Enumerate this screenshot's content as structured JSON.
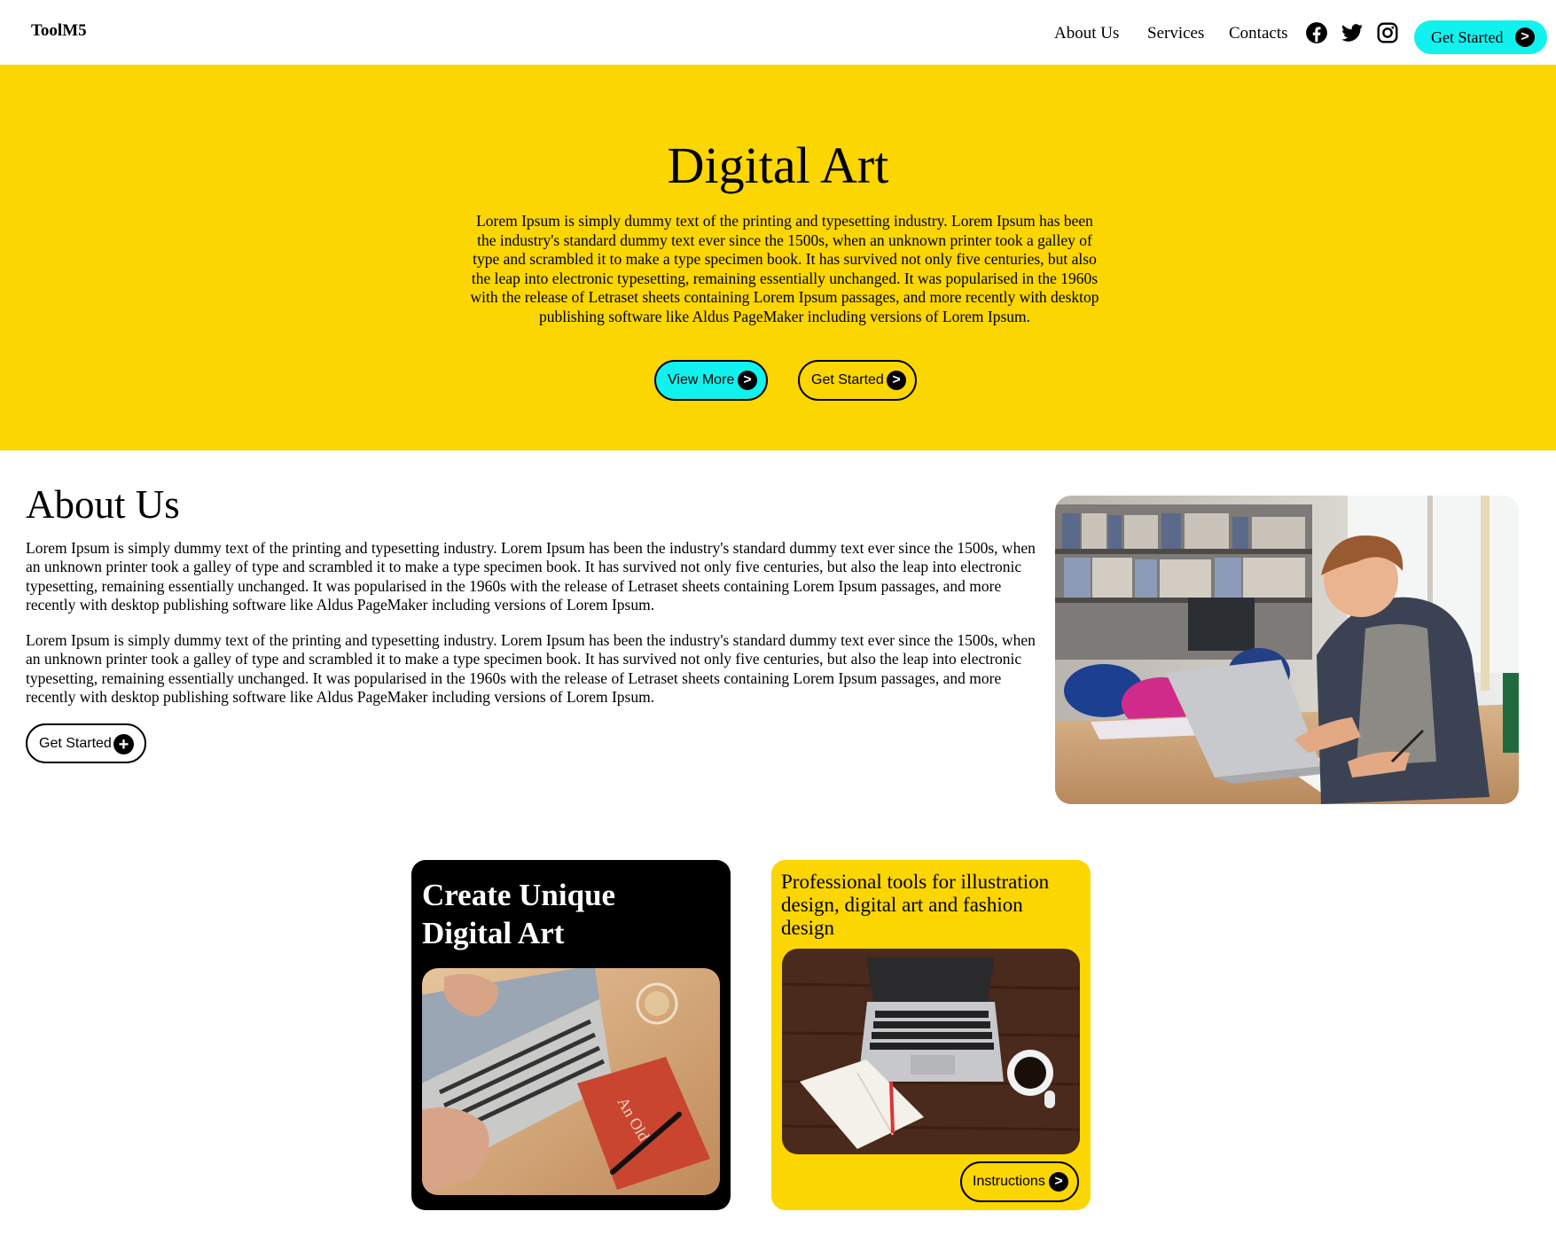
{
  "header": {
    "brand": "ToolM5",
    "nav": {
      "about": "About Us",
      "services": "Services",
      "contacts": "Contacts"
    },
    "cta_label": "Get Started",
    "cta_arrow": ">",
    "social_icons": [
      "facebook-icon",
      "twitter-icon",
      "instagram-icon"
    ]
  },
  "hero": {
    "title": "Digital Art",
    "text": "Lorem Ipsum is simply dummy text of the printing and typesetting industry. Lorem Ipsum has been the industry's standard dummy text ever since the 1500s, when an unknown printer took a galley of type and scrambled it to make a type specimen book. It has survived not only five centuries, but also the leap into electronic typesetting, remaining essentially unchanged. It was popularised in the 1960s with the release of Letraset sheets containing Lorem Ipsum passages, and more recently with desktop publishing software like Aldus PageMaker including versions of Lorem Ipsum.",
    "view_more": "View More",
    "get_started": "Get Started",
    "arrow": ">"
  },
  "about": {
    "title": "About Us",
    "paragraph1": "Lorem Ipsum is simply dummy text of the printing and typesetting industry. Lorem Ipsum has been the industry's standard dummy text ever since the 1500s, when an unknown printer took a galley of type and scrambled it to make a type specimen book. It has survived not only five centuries, but also the leap into electronic typesetting, remaining essentially unchanged. It was popularised in the 1960s with the release of Letraset sheets containing Lorem Ipsum passages, and more recently with desktop publishing software like Aldus PageMaker including versions of Lorem Ipsum.",
    "paragraph2": "Lorem Ipsum is simply dummy text of the printing and typesetting industry. Lorem Ipsum has been the industry's standard dummy text ever since the 1500s, when an unknown printer took a galley of type and scrambled it to make a type specimen book. It has survived not only five centuries, but also the leap into electronic typesetting, remaining essentially unchanged. It was popularised in the 1960s with the release of Letraset sheets containing Lorem Ipsum passages, and more recently with desktop publishing software like Aldus PageMaker including versions of Lorem Ipsum.",
    "button": "Get Started",
    "button_icon": "+"
  },
  "cards": {
    "dark": {
      "title_line1": "Create Unique",
      "title_line2": "Digital Art"
    },
    "yellow": {
      "title": "Professional tools for illustration design, digital art and fashion design",
      "button": "Instructions",
      "arrow": ">"
    }
  },
  "colors": {
    "yellow": "#fbd600",
    "cyan": "#11f2ef",
    "black": "#000000"
  }
}
